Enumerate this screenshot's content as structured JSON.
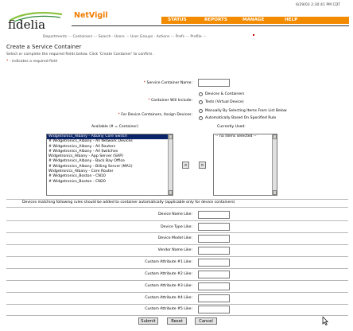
{
  "header": {
    "date": "6/29/03 2:30:41 PM CDT",
    "logo_text": "fidelia",
    "app_name": "NetVigil",
    "nav": [
      "STATUS",
      "REPORTS",
      "MANAGE",
      "HELP"
    ],
    "breadcrumb": "Departments ··· Containers ··· Search · Users ··· User Groups · Actions ··· Prefs ··· Profile ···"
  },
  "page": {
    "title": "Create a Service Container",
    "description": "Select or complete the required fields below. Click 'Create Container' to confirm.",
    "required_note": "- indicates a required field",
    "required_mark": "*"
  },
  "form": {
    "name_label": "Service Container Name:",
    "name_value": "",
    "include_label": "Container Will Include:",
    "include_options": [
      "Devices & Containers",
      "Tests (Virtual Device)"
    ],
    "assign_label": "For Device Containers, Assign Devices:",
    "assign_options": [
      "Manually By Selecting Items From List Below",
      "Automatically Based On Specified Rule"
    ],
    "available_label": "Available (# = Container)",
    "currently_used_label": "Currently Used:",
    "available_items": [
      "Widgetronics_Albany - Albany Core Switch",
      "# Widgetronics_Albany - All Network Devices",
      "# Widgetronics_Albany - All Routers",
      "# Widgetronics_Albany - All Switches",
      "Widgetronics_Albany - App Server (SAP)",
      "# Widgetronics_Albany - Back Bay Office",
      "# Widgetronics_Albany - Billing Server (MA1)",
      "Widgetronics_Albany - Core Router",
      "# Widgetronics_Boston - CN10",
      "# Widgetronics_Boston - CN20"
    ],
    "used_items": [
      "-- no items selected --"
    ],
    "move_left": "<",
    "move_right": ">",
    "rule_heading": "Devices matching following rules should be added to container automatically (applicable only for device containers)",
    "rule_fields": [
      {
        "label": "Device Name Like:",
        "value": ""
      },
      {
        "label": "Device Type Like:",
        "value": ""
      },
      {
        "label": "Device Model Like:",
        "value": ""
      },
      {
        "label": "Vendor Name Like:",
        "value": ""
      },
      {
        "label": "Custom Attribute #1 Like:",
        "value": ""
      },
      {
        "label": "Custom Attribute #2 Like:",
        "value": ""
      },
      {
        "label": "Custom Attribute #3 Like:",
        "value": ""
      },
      {
        "label": "Custom Attribute #4 Like:",
        "value": ""
      },
      {
        "label": "Custom Attribute #5 Like:",
        "value": ""
      }
    ],
    "buttons": {
      "submit": "Submit",
      "reset": "Reset",
      "cancel": "Cancel"
    }
  }
}
